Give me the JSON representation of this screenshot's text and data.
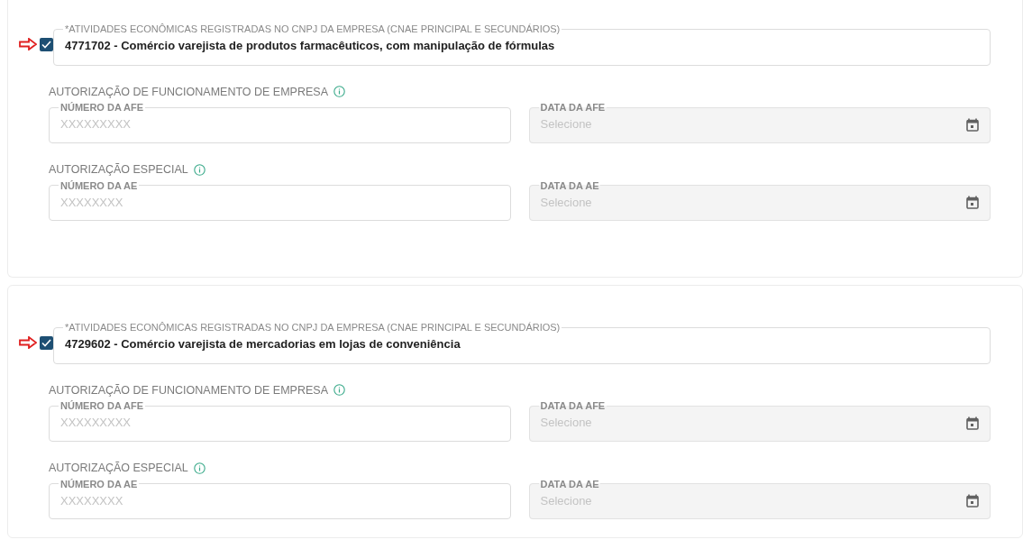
{
  "sections": [
    {
      "activity": {
        "label": "*ATIVIDADES ECONÔMICAS REGISTRADAS NO CNPJ DA EMPRESA (CNAE PRINCIPAL E SECUNDÁRIOS)",
        "value": "4771702 - Comércio varejista de produtos farmacêuticos, com manipulação de fórmulas",
        "checked": true
      },
      "groups": [
        {
          "title": "AUTORIZAÇÃO DE FUNCIONAMENTO DE EMPRESA",
          "fields": [
            {
              "kind": "text",
              "label": "NÚMERO DA AFE",
              "placeholder": "XXXXXXXXX"
            },
            {
              "kind": "date",
              "label": "DATA DA AFE",
              "placeholder": "Selecione"
            }
          ]
        },
        {
          "title": "AUTORIZAÇÃO ESPECIAL",
          "fields": [
            {
              "kind": "text",
              "label": "NÚMERO DA AE",
              "placeholder": "XXXXXXXX"
            },
            {
              "kind": "date",
              "label": "DATA DA AE",
              "placeholder": "Selecione"
            }
          ]
        }
      ]
    },
    {
      "activity": {
        "label": "*ATIVIDADES ECONÔMICAS REGISTRADAS NO CNPJ DA EMPRESA (CNAE PRINCIPAL E SECUNDÁRIOS)",
        "value": "4729602 - Comércio varejista de mercadorias em lojas de conveniência",
        "checked": true
      },
      "groups": [
        {
          "title": "AUTORIZAÇÃO DE FUNCIONAMENTO DE EMPRESA",
          "fields": [
            {
              "kind": "text",
              "label": "NÚMERO DA AFE",
              "placeholder": "XXXXXXXXX"
            },
            {
              "kind": "date",
              "label": "DATA DA AFE",
              "placeholder": "Selecione"
            }
          ]
        },
        {
          "title": "AUTORIZAÇÃO ESPECIAL",
          "fields": [
            {
              "kind": "text",
              "label": "NÚMERO DA AE",
              "placeholder": "XXXXXXXX"
            },
            {
              "kind": "date",
              "label": "DATA DA AE",
              "placeholder": "Selecione"
            }
          ]
        }
      ]
    }
  ]
}
